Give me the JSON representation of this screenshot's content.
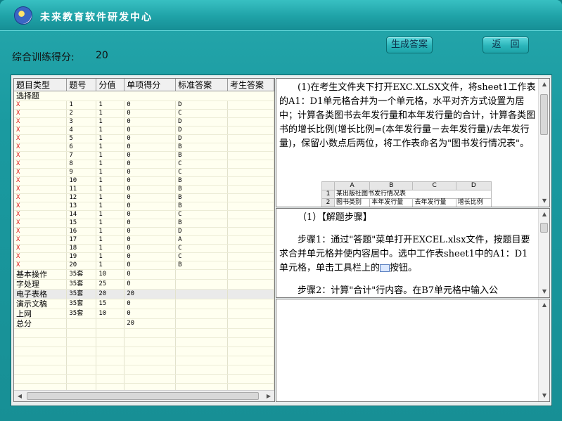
{
  "app": {
    "title": "未来教育软件研发中心"
  },
  "score": {
    "label": "综合训练得分:",
    "value": "20"
  },
  "buttons": {
    "generate": "生成答案",
    "back": "返　回"
  },
  "grid": {
    "columns": [
      "题目类型",
      "题号",
      "分值",
      "单项得分",
      "标准答案",
      "考生答案"
    ],
    "category_mc": "选择题",
    "rows": [
      [
        "X",
        "1",
        "1",
        "0",
        "D",
        ""
      ],
      [
        "X",
        "2",
        "1",
        "0",
        "C",
        ""
      ],
      [
        "X",
        "3",
        "1",
        "0",
        "D",
        ""
      ],
      [
        "X",
        "4",
        "1",
        "0",
        "D",
        ""
      ],
      [
        "X",
        "5",
        "1",
        "0",
        "D",
        ""
      ],
      [
        "X",
        "6",
        "1",
        "0",
        "B",
        ""
      ],
      [
        "X",
        "7",
        "1",
        "0",
        "B",
        ""
      ],
      [
        "X",
        "8",
        "1",
        "0",
        "C",
        ""
      ],
      [
        "X",
        "9",
        "1",
        "0",
        "C",
        ""
      ],
      [
        "X",
        "10",
        "1",
        "0",
        "B",
        ""
      ],
      [
        "X",
        "11",
        "1",
        "0",
        "B",
        ""
      ],
      [
        "X",
        "12",
        "1",
        "0",
        "B",
        ""
      ],
      [
        "X",
        "13",
        "1",
        "0",
        "B",
        ""
      ],
      [
        "X",
        "14",
        "1",
        "0",
        "C",
        ""
      ],
      [
        "X",
        "15",
        "1",
        "0",
        "B",
        ""
      ],
      [
        "X",
        "16",
        "1",
        "0",
        "D",
        ""
      ],
      [
        "X",
        "17",
        "1",
        "0",
        "A",
        ""
      ],
      [
        "X",
        "18",
        "1",
        "0",
        "C",
        ""
      ],
      [
        "X",
        "19",
        "1",
        "0",
        "C",
        ""
      ],
      [
        "X",
        "20",
        "1",
        "0",
        "B",
        ""
      ]
    ],
    "summary_rows": [
      [
        "基本操作",
        "35套",
        "10",
        "0"
      ],
      [
        "字处理",
        "35套",
        "25",
        "0"
      ],
      [
        "电子表格",
        "35套",
        "20",
        "20"
      ],
      [
        "演示文稿",
        "35套",
        "15",
        "0"
      ],
      [
        "上网",
        "35套",
        "10",
        "0"
      ],
      [
        "总分",
        "",
        "",
        "20"
      ]
    ]
  },
  "question": {
    "text": "(1)在考生文件夹下打开EXC.XLSX文件，将sheet1工作表的A1：D1单元格合并为一个单元格，水平对齐方式设置为居中；计算各类图书去年发行量和本年发行量的合计，计算各类图书的增长比例(增长比例=(本年发行量－去年发行量)/去年发行量)，保留小数点后两位，将工作表命名为\"图书发行情况表\"。",
    "sheet": {
      "headers": [
        "A",
        "B",
        "C",
        "D"
      ],
      "row1": [
        "1",
        "某出版社图书发行情况表",
        "",
        "",
        ""
      ],
      "row2": [
        "2",
        "图书类别",
        "本年发行量",
        "去年发行量",
        "增长比例"
      ]
    }
  },
  "solution": {
    "heading": "（1）【解题步骤】",
    "step1_a": "步骤1：通过\"答题\"菜单打开EXCEL.xlsx文件，按题目要求合并单元格并使内容居中。选中工作表sheet1中的A1：D1单元格，单击工具栏上的",
    "step1_b": "按钮。",
    "step2": "步骤2：计算\"合计\"行内容。在B7单元格中输入公"
  },
  "colors": {
    "accent": "#1fa2a7",
    "wrong_mark": "#e01818"
  }
}
